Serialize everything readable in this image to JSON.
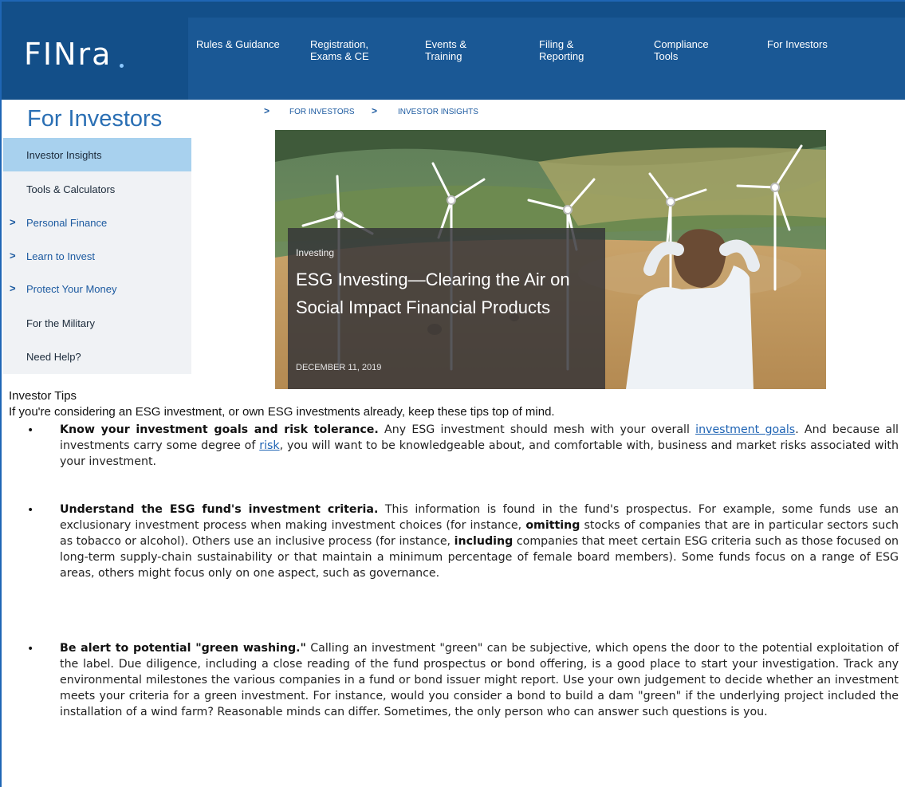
{
  "header": {
    "logo": "FINra",
    "nav": [
      {
        "label": "Rules & Guidance"
      },
      {
        "label": "Registration,\nExams & CE"
      },
      {
        "label": "Events &\nTraining"
      },
      {
        "label": "Filing &\nReporting"
      },
      {
        "label": "Compliance\nTools"
      },
      {
        "label": "For Investors"
      }
    ]
  },
  "sidebar": {
    "title": "For Investors",
    "items": [
      {
        "label": "Investor Insights",
        "active": true,
        "arrow": ""
      },
      {
        "label": "Tools & Calculators",
        "arrow": ""
      },
      {
        "label": "Personal Finance",
        "arrow": ">"
      },
      {
        "label": "Learn to Invest",
        "arrow": ">"
      },
      {
        "label": "Protect Your Money",
        "arrow": ">"
      },
      {
        "label": "For the Military",
        "arrow": ""
      },
      {
        "label": "Need Help?",
        "arrow": ""
      }
    ]
  },
  "breadcrumb": {
    "sep": ">",
    "items": [
      "FOR INVESTORS",
      "INVESTOR INSIGHTS"
    ]
  },
  "hero": {
    "category": "Investing",
    "title": "ESG Investing—Clearing the Air on Social Impact Financial Products",
    "date": "DECEMBER 11, 2019"
  },
  "content": {
    "heading": "Investor Tips",
    "intro": "If you're considering an ESG investment, or own ESG investments already, keep these tips top of mind.",
    "bullet": "•",
    "tips": [
      {
        "bold": "Know your investment goals and risk tolerance.",
        "text1": " Any ESG investment should mesh with your overall ",
        "link1": "investment goals",
        "text2": ". And because all investments carry some degree of ",
        "link2": "risk",
        "text3": ", you will want to be knowledgeable about, and comfortable with, business and market risks associated with your investment."
      },
      {
        "bold": "Understand the ESG fund's investment criteria.",
        "text1": " This information is found in the fund's prospectus. For example, some funds use an exclusionary investment process when making investment choices (for instance, ",
        "em1": "omitting",
        "text2": " stocks of companies that are in particular sectors such as tobacco or alcohol). Others use an inclusive process (for instance, ",
        "em2": "including",
        "text3": " companies that meet certain ESG criteria such as those focused on long-term supply-chain sustainability or that maintain a minimum percentage of female board members). Some funds focus on a range of ESG areas, others might focus only on one aspect, such as governance."
      },
      {
        "bold": "Be alert to potential \"green washing.\"",
        "text1": " Calling an investment \"green\" can be subjective, which opens the door to the potential exploitation of the label. Due diligence, including a close reading of the fund prospectus or bond offering, is a good place to start your investigation. Track any environmental milestones the various companies in a fund or bond issuer might report. Use your own judgement to decide whether an investment meets your criteria for a green investment. For instance, would you consider a bond to build a dam \"green\" if the underlying project included the installation of a wind farm? Reasonable minds can differ. Sometimes, the only person who can answer such questions is you."
      }
    ]
  },
  "colors": {
    "header": "#134f89",
    "nav_band": "#1a5895",
    "accent": "#2a6fb4",
    "active_item": "#a8d1ee",
    "link": "#1d62b3"
  }
}
